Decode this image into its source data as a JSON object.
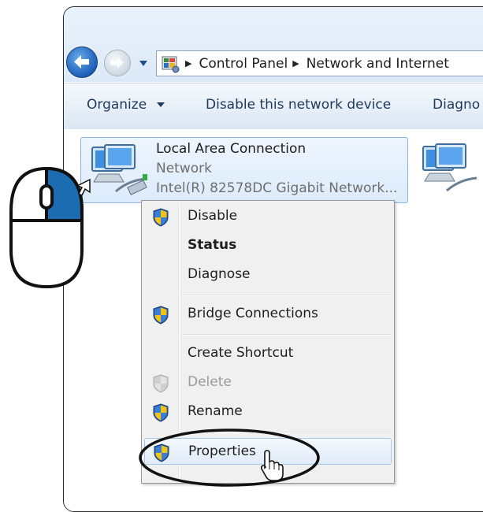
{
  "address_bar": {
    "crumbs": [
      "Control Panel",
      "Network and Internet"
    ],
    "icon": "control-panel-icon"
  },
  "toolbar": {
    "organize": "Organize",
    "disable_device": "Disable this network device",
    "diagnose": "Diagno"
  },
  "connection": {
    "title": "Local Area Connection",
    "subtitle": "Network",
    "device": "Intel(R) 82578DC Gigabit Network...",
    "icon": "network-computer-icon"
  },
  "context_menu": {
    "items": [
      {
        "label": "Disable",
        "shield": true,
        "disabled": false,
        "bold": false
      },
      {
        "label": "Status",
        "shield": false,
        "disabled": false,
        "bold": true
      },
      {
        "label": "Diagnose",
        "shield": false,
        "disabled": false,
        "bold": false
      },
      {
        "label": "Bridge Connections",
        "shield": true,
        "disabled": false,
        "bold": false
      },
      {
        "label": "Create Shortcut",
        "shield": false,
        "disabled": false,
        "bold": false
      },
      {
        "label": "Delete",
        "shield": true,
        "disabled": true,
        "bold": false
      },
      {
        "label": "Rename",
        "shield": true,
        "disabled": false,
        "bold": false
      },
      {
        "label": "Properties",
        "shield": true,
        "disabled": false,
        "bold": false,
        "highlighted": true
      }
    ]
  },
  "colors": {
    "accent_blue": "#1b6cb0",
    "selection_border": "#8cb4e3",
    "toolbar_text": "#1e395b"
  },
  "annotations": {
    "mouse": "mouse-right-click-icon",
    "highlight": "highlight-oval"
  }
}
